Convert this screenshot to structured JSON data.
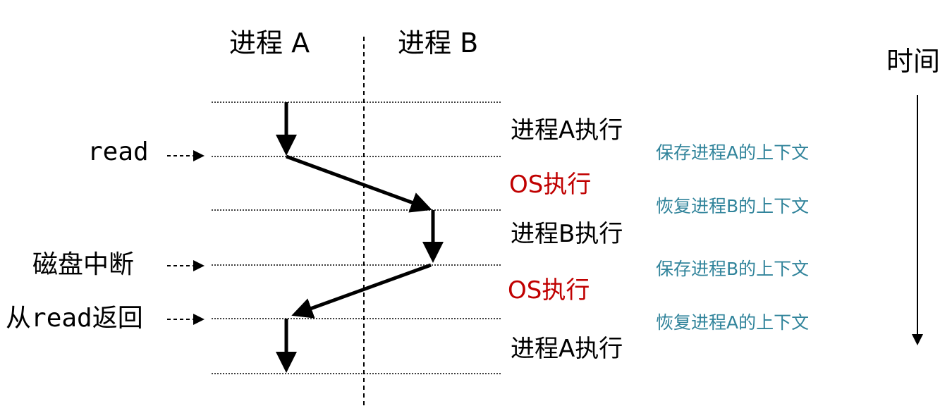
{
  "headers": {
    "process_a": "进程 A",
    "process_b": "进程 B",
    "time": "时间"
  },
  "events": {
    "read": "read",
    "disk_interrupt": "磁盘中断",
    "return_prefix": "从",
    "return_read": "read",
    "return_suffix": "返回"
  },
  "phases": [
    "进程A执行",
    "OS执行",
    "进程B执行",
    "OS执行",
    "进程A执行"
  ],
  "context_notes": [
    "保存进程A的上下文",
    "恢复进程B的上下文",
    "保存进程B的上下文",
    "恢复进程A的上下文"
  ],
  "colors": {
    "os_text": "#c00000",
    "context_text": "#31849b",
    "line": "#000000"
  }
}
